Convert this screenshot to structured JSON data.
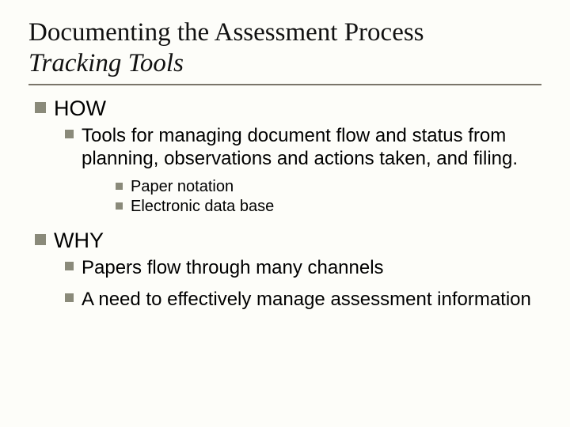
{
  "title": {
    "line1": "Documenting the Assessment Process",
    "line2": "Tracking Tools"
  },
  "sections": {
    "how": {
      "label": "HOW",
      "sub1": "Tools for managing document flow and status from planning, observations and actions taken, and filing.",
      "sub2a": "Paper notation",
      "sub2b": "Electronic data base"
    },
    "why": {
      "label": "WHY",
      "sub1": "Papers flow through many channels",
      "sub2": "A need to effectively manage assessment information"
    }
  }
}
